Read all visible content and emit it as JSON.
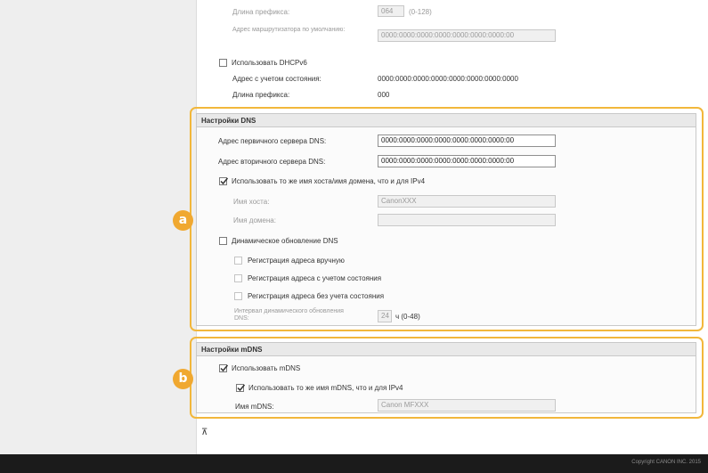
{
  "ipv6_top": {
    "prefix_length_label": "Длина префикса:",
    "prefix_length_value": "064",
    "prefix_length_range": "(0-128)",
    "default_router_label": "Адрес маршрутизатора по умолчанию:",
    "default_router_value": "0000:0000:0000:0000:0000:0000:0000:00",
    "use_dhcpv6_label": "Использовать DHCPv6",
    "stateful_address_label": "Адрес с учетом состояния:",
    "stateful_address_value": "0000:0000:0000:0000:0000:0000:0000:0000",
    "prefix_length2_label": "Длина префикса:",
    "prefix_length2_value": "000"
  },
  "dns": {
    "header": "Настройки DNS",
    "primary_label": "Адрес первичного сервера DNS:",
    "primary_value": "0000:0000:0000:0000:0000:0000:0000:00",
    "secondary_label": "Адрес вторичного сервера DNS:",
    "secondary_value": "0000:0000:0000:0000:0000:0000:0000:00",
    "use_same_host_label": "Использовать то же имя хоста/имя домена, что и для IPv4",
    "use_same_host_checked": true,
    "host_name_label": "Имя хоста:",
    "host_name_value": "CanonXXX",
    "domain_name_label": "Имя домена:",
    "domain_name_value": "",
    "dynamic_update_label": "Динамическое обновление DNS",
    "dynamic_update_checked": false,
    "manual_reg_label": "Регистрация адреса вручную",
    "stateful_reg_label": "Регистрация адреса с учетом состояния",
    "stateless_reg_label": "Регистрация адреса без учета состояния",
    "interval_label": "Интервал динамического обновления DNS:",
    "interval_value": "24",
    "interval_unit": "ч (0-48)"
  },
  "mdns": {
    "header": "Настройки mDNS",
    "use_mdns_label": "Использовать mDNS",
    "use_mdns_checked": true,
    "use_same_mdns_label": "Использовать то же имя mDNS, что и для IPv4",
    "use_same_mdns_checked": true,
    "mdns_name_label": "Имя mDNS:",
    "mdns_name_value": "Canon MFXXX"
  },
  "callouts": {
    "a": "a",
    "b": "b"
  },
  "scroll_top_glyph": "⊼",
  "footer": {
    "copyright": "Copyright CANON INC. 2015"
  },
  "colors": {
    "highlight": "#f2b73b",
    "badge": "#f0a830",
    "footer": "#1b1b1b"
  }
}
